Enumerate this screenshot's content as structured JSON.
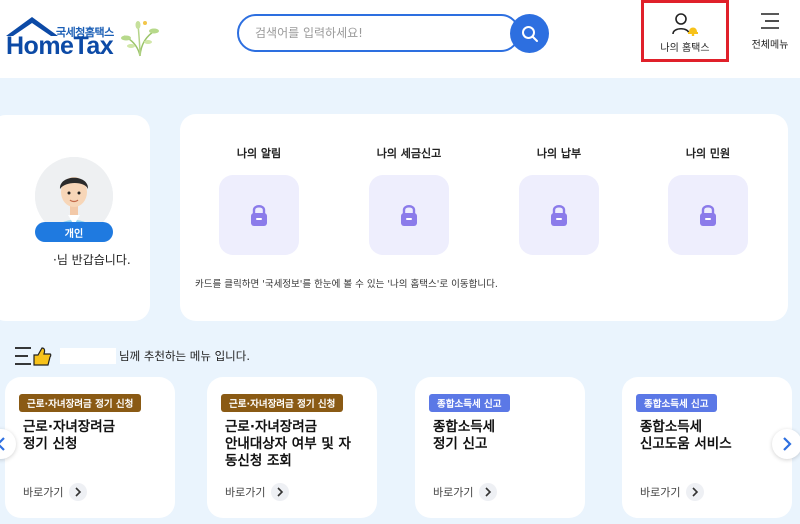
{
  "header": {
    "logo_kr": "국세청홈택스",
    "logo_en": "HomeTax",
    "search_placeholder": "검색어를 입력하세요!",
    "my_hometax_label": "나의 홈택스",
    "all_menu_label": "전체메뉴"
  },
  "profile": {
    "badge": "개인",
    "greeting": "·님 반갑습니다."
  },
  "my_cards": {
    "items": [
      {
        "label": "나의 알림"
      },
      {
        "label": "나의 세금신고"
      },
      {
        "label": "나의 납부"
      },
      {
        "label": "나의 민원"
      }
    ],
    "note": "카드를 클릭하면 '국세정보'를 한눈에 볼 수 있는 '나의 홈택스'로 이동합니다."
  },
  "recommend": {
    "title_suffix": "님께 추천하는 메뉴 입니다.",
    "more_label": "바로가기",
    "cards": [
      {
        "tag": "근로·자녀장려금 정기 신청",
        "tag_color": "#8a5a14",
        "name": "근로·자녀장려금\n정기 신청"
      },
      {
        "tag": "근로·자녀장려금 정기 신청",
        "tag_color": "#8a5a14",
        "name": "근로·자녀장려금\n안내대상자 여부 및 자\n동신청 조회"
      },
      {
        "tag": "종합소득세 신고",
        "tag_color": "#5b78e6",
        "name": "종합소득세\n정기 신고"
      },
      {
        "tag": "종합소득세 신고",
        "tag_color": "#5b78e6",
        "name": "종합소득세\n신고도움 서비스"
      }
    ]
  },
  "colors": {
    "primary": "#2d6fe0",
    "highlight_border": "#e0202a",
    "background": "#eaf4fd"
  }
}
